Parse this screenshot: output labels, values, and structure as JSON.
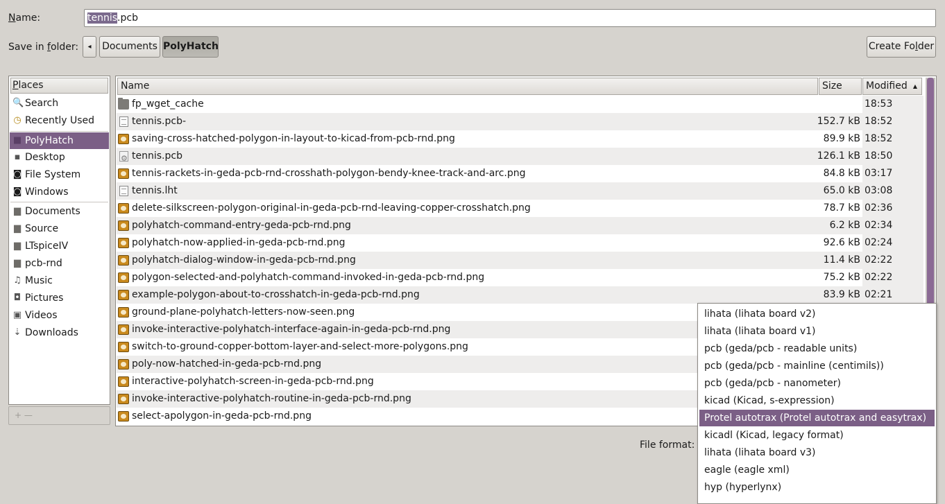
{
  "name_row": {
    "label_prefix": "N",
    "label_rest": "ame:",
    "filename_selected": "tennis",
    "filename_rest": ".pcb"
  },
  "folder_row": {
    "label_prefix": "Save in ",
    "label_accel": "f",
    "label_rest": "older:",
    "back_arrow": "◂",
    "crumbs": [
      "Documents",
      "PolyHatch"
    ],
    "create_folder_prefix": "Create Fo",
    "create_folder_accel": "l",
    "create_folder_rest": "der"
  },
  "places": {
    "header_accel": "P",
    "header_rest": "laces",
    "items": [
      {
        "label": "Search",
        "icon": "search-icon",
        "glyph": "🔍"
      },
      {
        "label": "Recently Used",
        "icon": "clock-icon",
        "glyph": "◷"
      },
      {
        "label": "PolyHatch",
        "icon": "folder-icon",
        "glyph": "■",
        "selected": true
      },
      {
        "label": "Desktop",
        "icon": "desktop-icon",
        "glyph": "▪"
      },
      {
        "label": "File System",
        "icon": "drive-icon",
        "glyph": "◙"
      },
      {
        "label": "Windows",
        "icon": "drive-icon",
        "glyph": "◙"
      },
      {
        "label": "Documents",
        "icon": "folder-icon",
        "glyph": "▆"
      },
      {
        "label": "Source",
        "icon": "folder-icon",
        "glyph": "▆"
      },
      {
        "label": "LTspiceIV",
        "icon": "folder-icon",
        "glyph": "▆"
      },
      {
        "label": "pcb-rnd",
        "icon": "folder-icon",
        "glyph": "▆"
      },
      {
        "label": "Music",
        "icon": "music-icon",
        "glyph": "♫"
      },
      {
        "label": "Pictures",
        "icon": "camera-icon",
        "glyph": "◘"
      },
      {
        "label": "Videos",
        "icon": "film-icon",
        "glyph": "▣"
      },
      {
        "label": "Downloads",
        "icon": "download-icon",
        "glyph": "⇣"
      }
    ],
    "tools": "+   —"
  },
  "file_list": {
    "columns": {
      "name": "Name",
      "size": "Size",
      "modified": "Modified",
      "sort_arrow": "▲"
    },
    "rows": [
      {
        "name": "fp_wget_cache",
        "size": "",
        "modified": "18:53",
        "type": "folder"
      },
      {
        "name": "tennis.pcb-",
        "size": "152.7 kB",
        "modified": "18:52",
        "type": "doc"
      },
      {
        "name": "saving-cross-hatched-polygon-in-layout-to-kicad-from-pcb-rnd.png",
        "size": "89.9 kB",
        "modified": "18:52",
        "type": "img"
      },
      {
        "name": "tennis.pcb",
        "size": "126.1 kB",
        "modified": "18:50",
        "type": "gear"
      },
      {
        "name": "tennis-rackets-in-geda-pcb-rnd-crosshath-polygon-bendy-knee-track-and-arc.png",
        "size": "84.8 kB",
        "modified": "03:17",
        "type": "img"
      },
      {
        "name": "tennis.lht",
        "size": "65.0 kB",
        "modified": "03:08",
        "type": "doc"
      },
      {
        "name": "delete-silkscreen-polygon-original-in-geda-pcb-rnd-leaving-copper-crosshatch.png",
        "size": "78.7 kB",
        "modified": "02:36",
        "type": "img"
      },
      {
        "name": "polyhatch-command-entry-geda-pcb-rnd.png",
        "size": "6.2 kB",
        "modified": "02:34",
        "type": "img"
      },
      {
        "name": "polyhatch-now-applied-in-geda-pcb-rnd.png",
        "size": "92.6 kB",
        "modified": "02:24",
        "type": "img"
      },
      {
        "name": "polyhatch-dialog-window-in-geda-pcb-rnd.png",
        "size": "11.4 kB",
        "modified": "02:22",
        "type": "img"
      },
      {
        "name": "polygon-selected-and-polyhatch-command-invoked-in-geda-pcb-rnd.png",
        "size": "75.2 kB",
        "modified": "02:22",
        "type": "img"
      },
      {
        "name": "example-polygon-about-to-crosshatch-in-geda-pcb-rnd.png",
        "size": "83.9 kB",
        "modified": "02:21",
        "type": "img"
      },
      {
        "name": "ground-plane-polyhatch-letters-now-seen.png",
        "size": "",
        "modified": "",
        "type": "img"
      },
      {
        "name": "invoke-interactive-polyhatch-interface-again-in-geda-pcb-rnd.png",
        "size": "",
        "modified": "",
        "type": "img"
      },
      {
        "name": "switch-to-ground-copper-bottom-layer-and-select-more-polygons.png",
        "size": "",
        "modified": "",
        "type": "img"
      },
      {
        "name": "poly-now-hatched-in-geda-pcb-rnd.png",
        "size": "",
        "modified": "",
        "type": "img"
      },
      {
        "name": "interactive-polyhatch-screen-in-geda-pcb-rnd.png",
        "size": "",
        "modified": "",
        "type": "img"
      },
      {
        "name": "invoke-interactive-polyhatch-routine-in-geda-pcb-rnd.png",
        "size": "",
        "modified": "",
        "type": "img"
      },
      {
        "name": "select-apolygon-in-geda-pcb-rnd.png",
        "size": "",
        "modified": "",
        "type": "img"
      }
    ]
  },
  "file_format": {
    "label": "File format:",
    "options": [
      "lihata (lihata board v2)",
      "lihata (lihata board v1)",
      "pcb (geda/pcb - readable units)",
      "pcb (geda/pcb - mainline (centimils))",
      "pcb (geda/pcb - nanometer)",
      "kicad (Kicad, s-expression)",
      "Protel autotrax (Protel autotrax and easytrax)",
      "kicadl (Kicad, legacy format)",
      "lihata (lihata board v3)",
      "eagle (eagle xml)",
      "hyp (hyperlynx)"
    ],
    "selected": "Protel autotrax (Protel autotrax and easytrax)"
  },
  "colors": {
    "selection": "#7b5f86",
    "background": "#d6d3ce"
  }
}
